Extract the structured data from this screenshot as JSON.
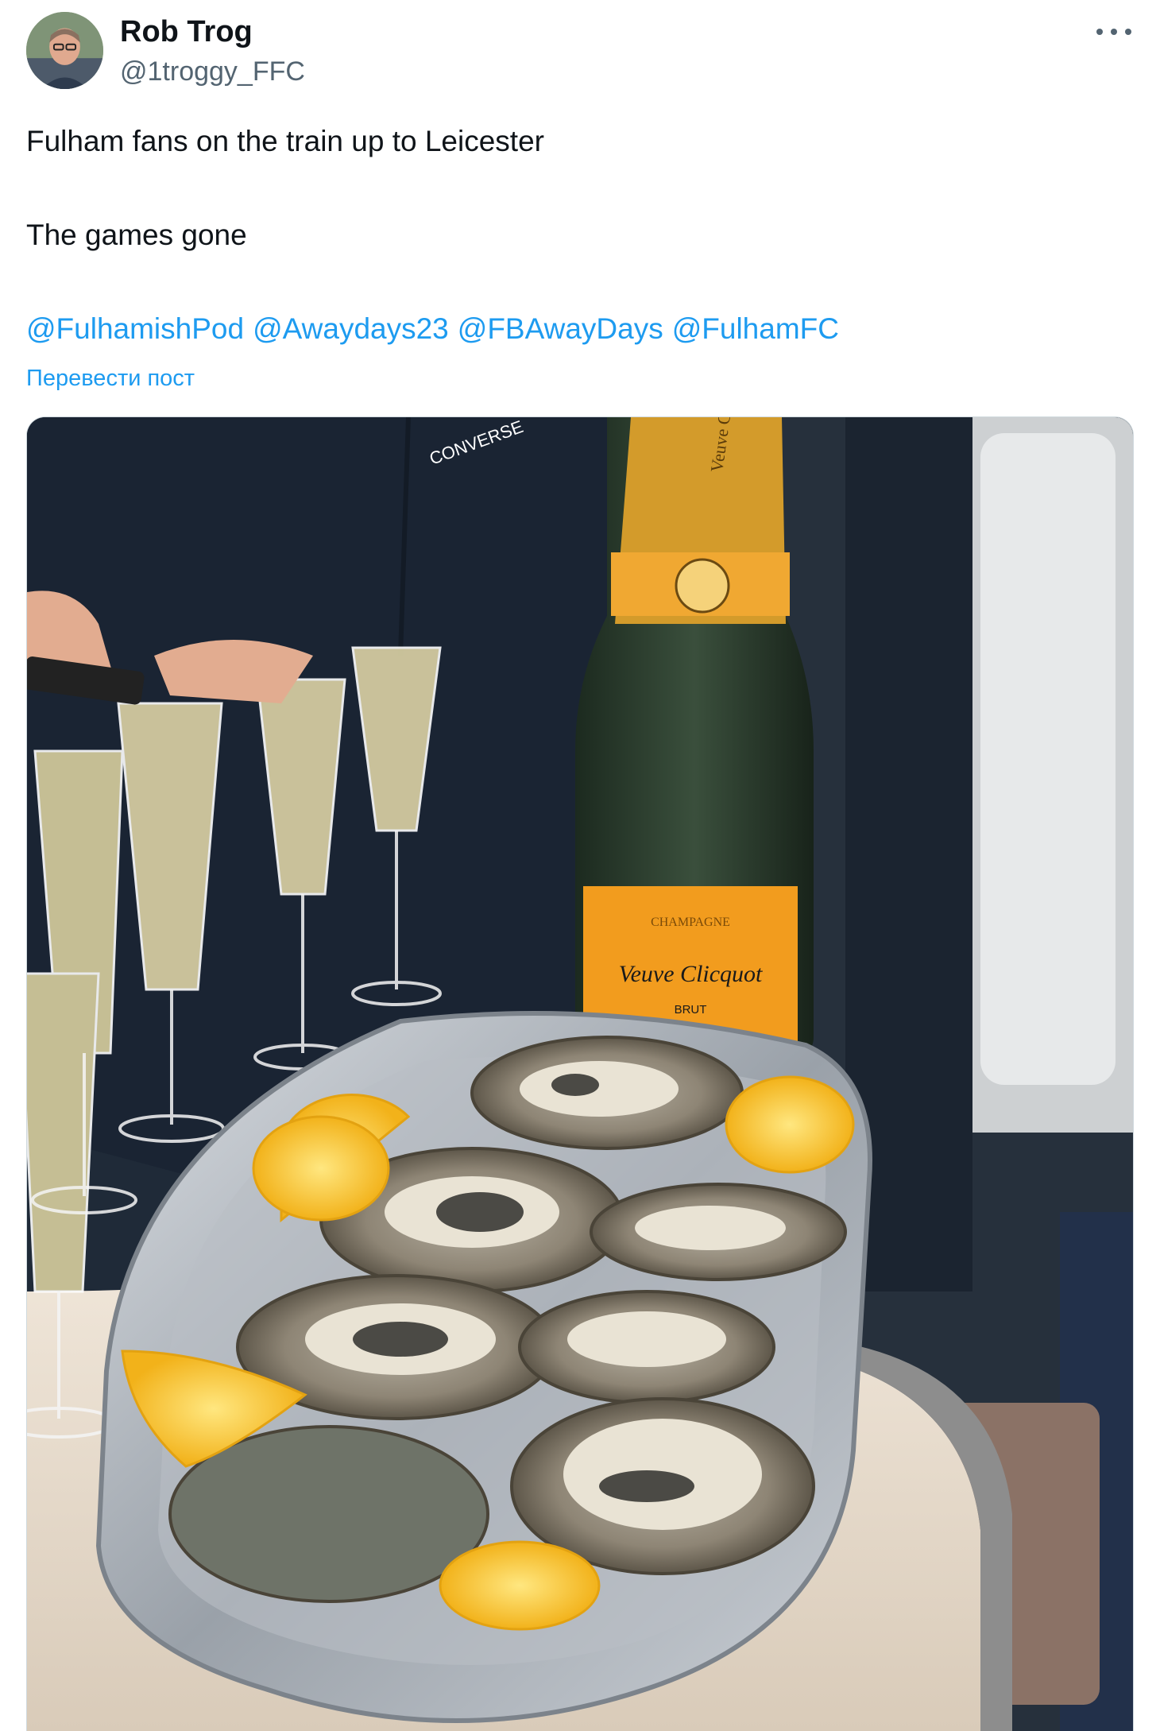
{
  "author": {
    "name": "Rob Trog",
    "handle": "@1troggy_FFC",
    "avatar_icon": "profile-photo"
  },
  "more_icon": "more-horizontal-icon",
  "text": {
    "line1": "Fulham fans on the train up to Leicester",
    "line2": "The games gone"
  },
  "mentions": [
    "@FulhamishPod",
    "@Awaydays23",
    "@FBAwayDays",
    "@FulhamFC"
  ],
  "translate_label": "Перевести пост",
  "colors": {
    "link": "#1d9bf0",
    "text": "#0f1419",
    "secondary": "#536471"
  },
  "media": {
    "label_brand": "Veuve Clicquot",
    "label_top": "CHAMPAGNE",
    "label_bottom": "BRUT",
    "neck_brand": "Veuve Clicquot",
    "hoodie_logo": "CONVERSE"
  }
}
